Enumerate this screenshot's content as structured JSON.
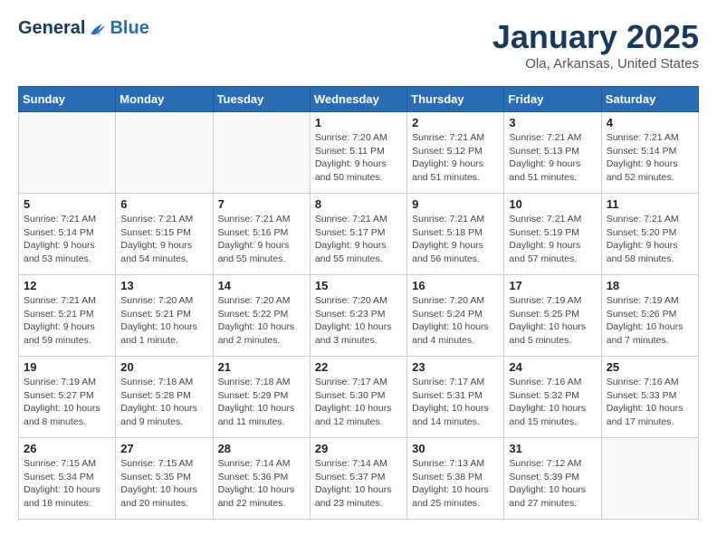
{
  "header": {
    "logo_general": "General",
    "logo_blue": "Blue",
    "month_title": "January 2025",
    "location": "Ola, Arkansas, United States"
  },
  "days_of_week": [
    "Sunday",
    "Monday",
    "Tuesday",
    "Wednesday",
    "Thursday",
    "Friday",
    "Saturday"
  ],
  "weeks": [
    [
      {
        "day": "",
        "info": ""
      },
      {
        "day": "",
        "info": ""
      },
      {
        "day": "",
        "info": ""
      },
      {
        "day": "1",
        "info": "Sunrise: 7:20 AM\nSunset: 5:11 PM\nDaylight: 9 hours\nand 50 minutes."
      },
      {
        "day": "2",
        "info": "Sunrise: 7:21 AM\nSunset: 5:12 PM\nDaylight: 9 hours\nand 51 minutes."
      },
      {
        "day": "3",
        "info": "Sunrise: 7:21 AM\nSunset: 5:13 PM\nDaylight: 9 hours\nand 51 minutes."
      },
      {
        "day": "4",
        "info": "Sunrise: 7:21 AM\nSunset: 5:14 PM\nDaylight: 9 hours\nand 52 minutes."
      }
    ],
    [
      {
        "day": "5",
        "info": "Sunrise: 7:21 AM\nSunset: 5:14 PM\nDaylight: 9 hours\nand 53 minutes."
      },
      {
        "day": "6",
        "info": "Sunrise: 7:21 AM\nSunset: 5:15 PM\nDaylight: 9 hours\nand 54 minutes."
      },
      {
        "day": "7",
        "info": "Sunrise: 7:21 AM\nSunset: 5:16 PM\nDaylight: 9 hours\nand 55 minutes."
      },
      {
        "day": "8",
        "info": "Sunrise: 7:21 AM\nSunset: 5:17 PM\nDaylight: 9 hours\nand 55 minutes."
      },
      {
        "day": "9",
        "info": "Sunrise: 7:21 AM\nSunset: 5:18 PM\nDaylight: 9 hours\nand 56 minutes."
      },
      {
        "day": "10",
        "info": "Sunrise: 7:21 AM\nSunset: 5:19 PM\nDaylight: 9 hours\nand 57 minutes."
      },
      {
        "day": "11",
        "info": "Sunrise: 7:21 AM\nSunset: 5:20 PM\nDaylight: 9 hours\nand 58 minutes."
      }
    ],
    [
      {
        "day": "12",
        "info": "Sunrise: 7:21 AM\nSunset: 5:21 PM\nDaylight: 9 hours\nand 59 minutes."
      },
      {
        "day": "13",
        "info": "Sunrise: 7:20 AM\nSunset: 5:21 PM\nDaylight: 10 hours\nand 1 minute."
      },
      {
        "day": "14",
        "info": "Sunrise: 7:20 AM\nSunset: 5:22 PM\nDaylight: 10 hours\nand 2 minutes."
      },
      {
        "day": "15",
        "info": "Sunrise: 7:20 AM\nSunset: 5:23 PM\nDaylight: 10 hours\nand 3 minutes."
      },
      {
        "day": "16",
        "info": "Sunrise: 7:20 AM\nSunset: 5:24 PM\nDaylight: 10 hours\nand 4 minutes."
      },
      {
        "day": "17",
        "info": "Sunrise: 7:19 AM\nSunset: 5:25 PM\nDaylight: 10 hours\nand 5 minutes."
      },
      {
        "day": "18",
        "info": "Sunrise: 7:19 AM\nSunset: 5:26 PM\nDaylight: 10 hours\nand 7 minutes."
      }
    ],
    [
      {
        "day": "19",
        "info": "Sunrise: 7:19 AM\nSunset: 5:27 PM\nDaylight: 10 hours\nand 8 minutes."
      },
      {
        "day": "20",
        "info": "Sunrise: 7:18 AM\nSunset: 5:28 PM\nDaylight: 10 hours\nand 9 minutes."
      },
      {
        "day": "21",
        "info": "Sunrise: 7:18 AM\nSunset: 5:29 PM\nDaylight: 10 hours\nand 11 minutes."
      },
      {
        "day": "22",
        "info": "Sunrise: 7:17 AM\nSunset: 5:30 PM\nDaylight: 10 hours\nand 12 minutes."
      },
      {
        "day": "23",
        "info": "Sunrise: 7:17 AM\nSunset: 5:31 PM\nDaylight: 10 hours\nand 14 minutes."
      },
      {
        "day": "24",
        "info": "Sunrise: 7:16 AM\nSunset: 5:32 PM\nDaylight: 10 hours\nand 15 minutes."
      },
      {
        "day": "25",
        "info": "Sunrise: 7:16 AM\nSunset: 5:33 PM\nDaylight: 10 hours\nand 17 minutes."
      }
    ],
    [
      {
        "day": "26",
        "info": "Sunrise: 7:15 AM\nSunset: 5:34 PM\nDaylight: 10 hours\nand 18 minutes."
      },
      {
        "day": "27",
        "info": "Sunrise: 7:15 AM\nSunset: 5:35 PM\nDaylight: 10 hours\nand 20 minutes."
      },
      {
        "day": "28",
        "info": "Sunrise: 7:14 AM\nSunset: 5:36 PM\nDaylight: 10 hours\nand 22 minutes."
      },
      {
        "day": "29",
        "info": "Sunrise: 7:14 AM\nSunset: 5:37 PM\nDaylight: 10 hours\nand 23 minutes."
      },
      {
        "day": "30",
        "info": "Sunrise: 7:13 AM\nSunset: 5:38 PM\nDaylight: 10 hours\nand 25 minutes."
      },
      {
        "day": "31",
        "info": "Sunrise: 7:12 AM\nSunset: 5:39 PM\nDaylight: 10 hours\nand 27 minutes."
      },
      {
        "day": "",
        "info": ""
      }
    ]
  ]
}
